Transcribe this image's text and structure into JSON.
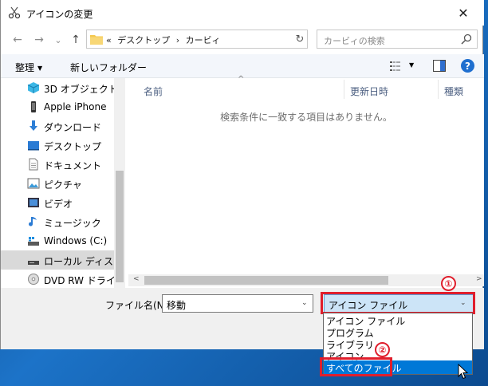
{
  "window": {
    "title": "アイコンの変更",
    "close_glyph": "✕"
  },
  "navigation": {
    "back_glyph": "←",
    "forward_glyph": "→",
    "history_glyph": "⌄",
    "up_glyph": "↑",
    "refresh_glyph": "↻"
  },
  "address": {
    "overflow": "«",
    "segments": [
      "デスクトップ",
      "›",
      "カービィ"
    ]
  },
  "search": {
    "placeholder": "カービィの検索"
  },
  "toolbar": {
    "organize_label": "整理",
    "organize_caret": "▼",
    "new_folder_label": "新しいフォルダー",
    "view_caret": "▼",
    "help_label": "?"
  },
  "sidebar": {
    "items": [
      {
        "label": "3D オブジェクト",
        "icon": "cube-icon"
      },
      {
        "label": "Apple iPhone",
        "icon": "phone-icon"
      },
      {
        "label": "ダウンロード",
        "icon": "download-icon"
      },
      {
        "label": "デスクトップ",
        "icon": "desktop-icon"
      },
      {
        "label": "ドキュメント",
        "icon": "document-icon"
      },
      {
        "label": "ピクチャ",
        "icon": "pictures-icon"
      },
      {
        "label": "ビデオ",
        "icon": "video-icon"
      },
      {
        "label": "ミュージック",
        "icon": "music-icon"
      },
      {
        "label": "Windows (C:)",
        "icon": "drive-c-icon"
      },
      {
        "label": "ローカル ディスク (D",
        "icon": "local-disk-icon",
        "selected": true
      },
      {
        "label": "DVD RW ドライブ (",
        "icon": "dvd-icon"
      }
    ]
  },
  "content": {
    "columns": [
      "名前",
      "更新日時",
      "種類"
    ],
    "sort_indicator": "^",
    "empty_message": "検索条件に一致する項目はありません。"
  },
  "hscroll": {
    "left_glyph": "<",
    "right_glyph": ">"
  },
  "bottom": {
    "filename_label": "ファイル名(N):",
    "filename_value": "移動",
    "dropdown_caret": "⌄",
    "filetype_value": "アイコン ファイル",
    "filetype_options": [
      "アイコン ファイル",
      "プログラム",
      "ライブラリ",
      "アイコン",
      "すべてのファイル"
    ],
    "highlighted_option": "すべてのファイル"
  },
  "annotations": {
    "marker1": "①",
    "marker2": "②",
    "color": "#e01e2c"
  }
}
